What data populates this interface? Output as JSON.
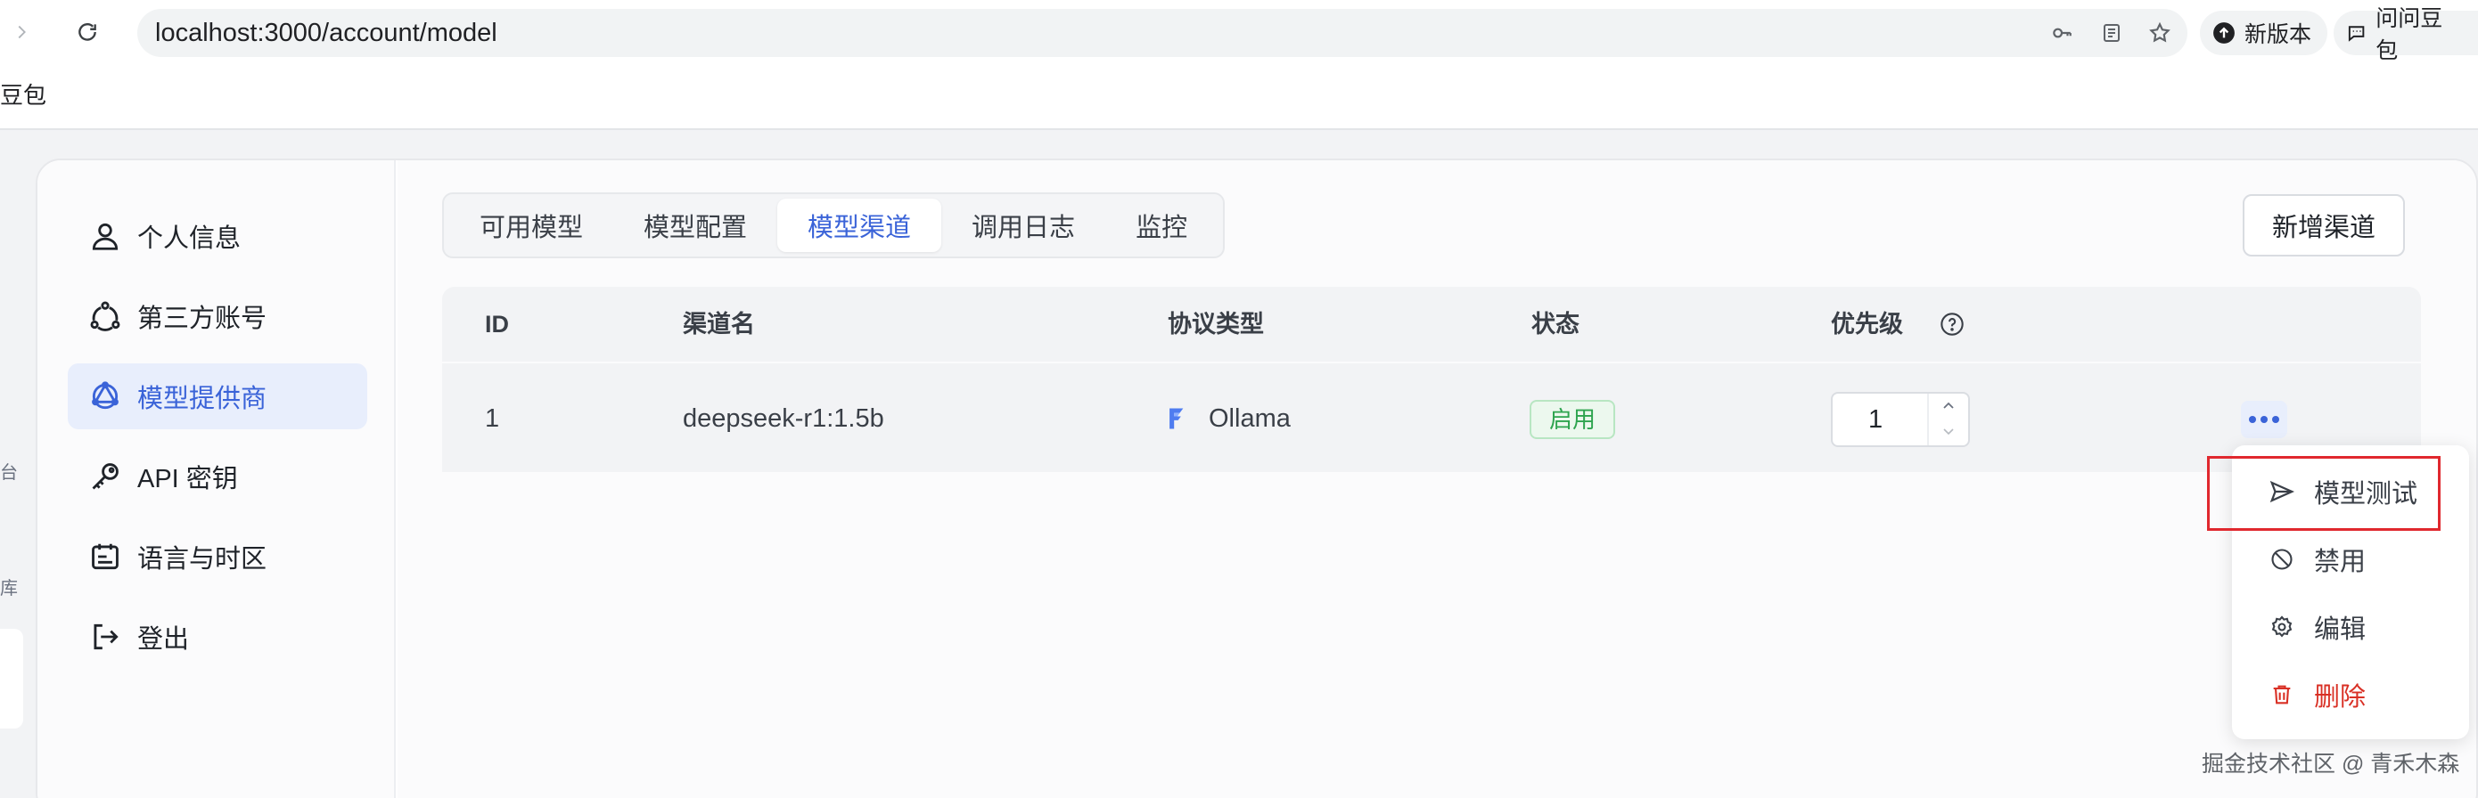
{
  "browser": {
    "url": "localhost:3000/account/model",
    "new_version_label": "新版本",
    "ask_doubao_label": "问问豆包"
  },
  "bookmark_bar": {
    "fragment": "豆包"
  },
  "edge_fragments": [
    "台",
    "库"
  ],
  "sidebar": {
    "items": [
      {
        "label": "个人信息",
        "icon": "user-icon",
        "active": false
      },
      {
        "label": "第三方账号",
        "icon": "linked-accounts-icon",
        "active": false
      },
      {
        "label": "模型提供商",
        "icon": "model-provider-icon",
        "active": true
      },
      {
        "label": "API 密钥",
        "icon": "key-icon",
        "active": false
      },
      {
        "label": "语言与时区",
        "icon": "calendar-icon",
        "active": false
      },
      {
        "label": "登出",
        "icon": "logout-icon",
        "active": false
      }
    ]
  },
  "tabs": [
    {
      "label": "可用模型",
      "active": false
    },
    {
      "label": "模型配置",
      "active": false
    },
    {
      "label": "模型渠道",
      "active": true
    },
    {
      "label": "调用日志",
      "active": false
    },
    {
      "label": "监控",
      "active": false
    }
  ],
  "add_channel_label": "新增渠道",
  "table": {
    "headers": {
      "id": "ID",
      "name": "渠道名",
      "protocol": "协议类型",
      "status": "状态",
      "priority": "优先级"
    },
    "rows": [
      {
        "id": "1",
        "name": "deepseek-r1:1.5b",
        "protocol": "Ollama",
        "status": "启用",
        "priority": "1"
      }
    ]
  },
  "dropdown": {
    "items": [
      {
        "label": "模型测试",
        "icon": "send-icon"
      },
      {
        "label": "禁用",
        "icon": "ban-icon"
      },
      {
        "label": "编辑",
        "icon": "gear-icon"
      },
      {
        "label": "删除",
        "icon": "trash-icon"
      }
    ]
  },
  "watermark": "掘金技术社区 @ 青禾木森",
  "colors": {
    "accent": "#3a63d8",
    "danger": "#d93025",
    "success": "#2ea44f",
    "highlight": "#e0282e"
  }
}
